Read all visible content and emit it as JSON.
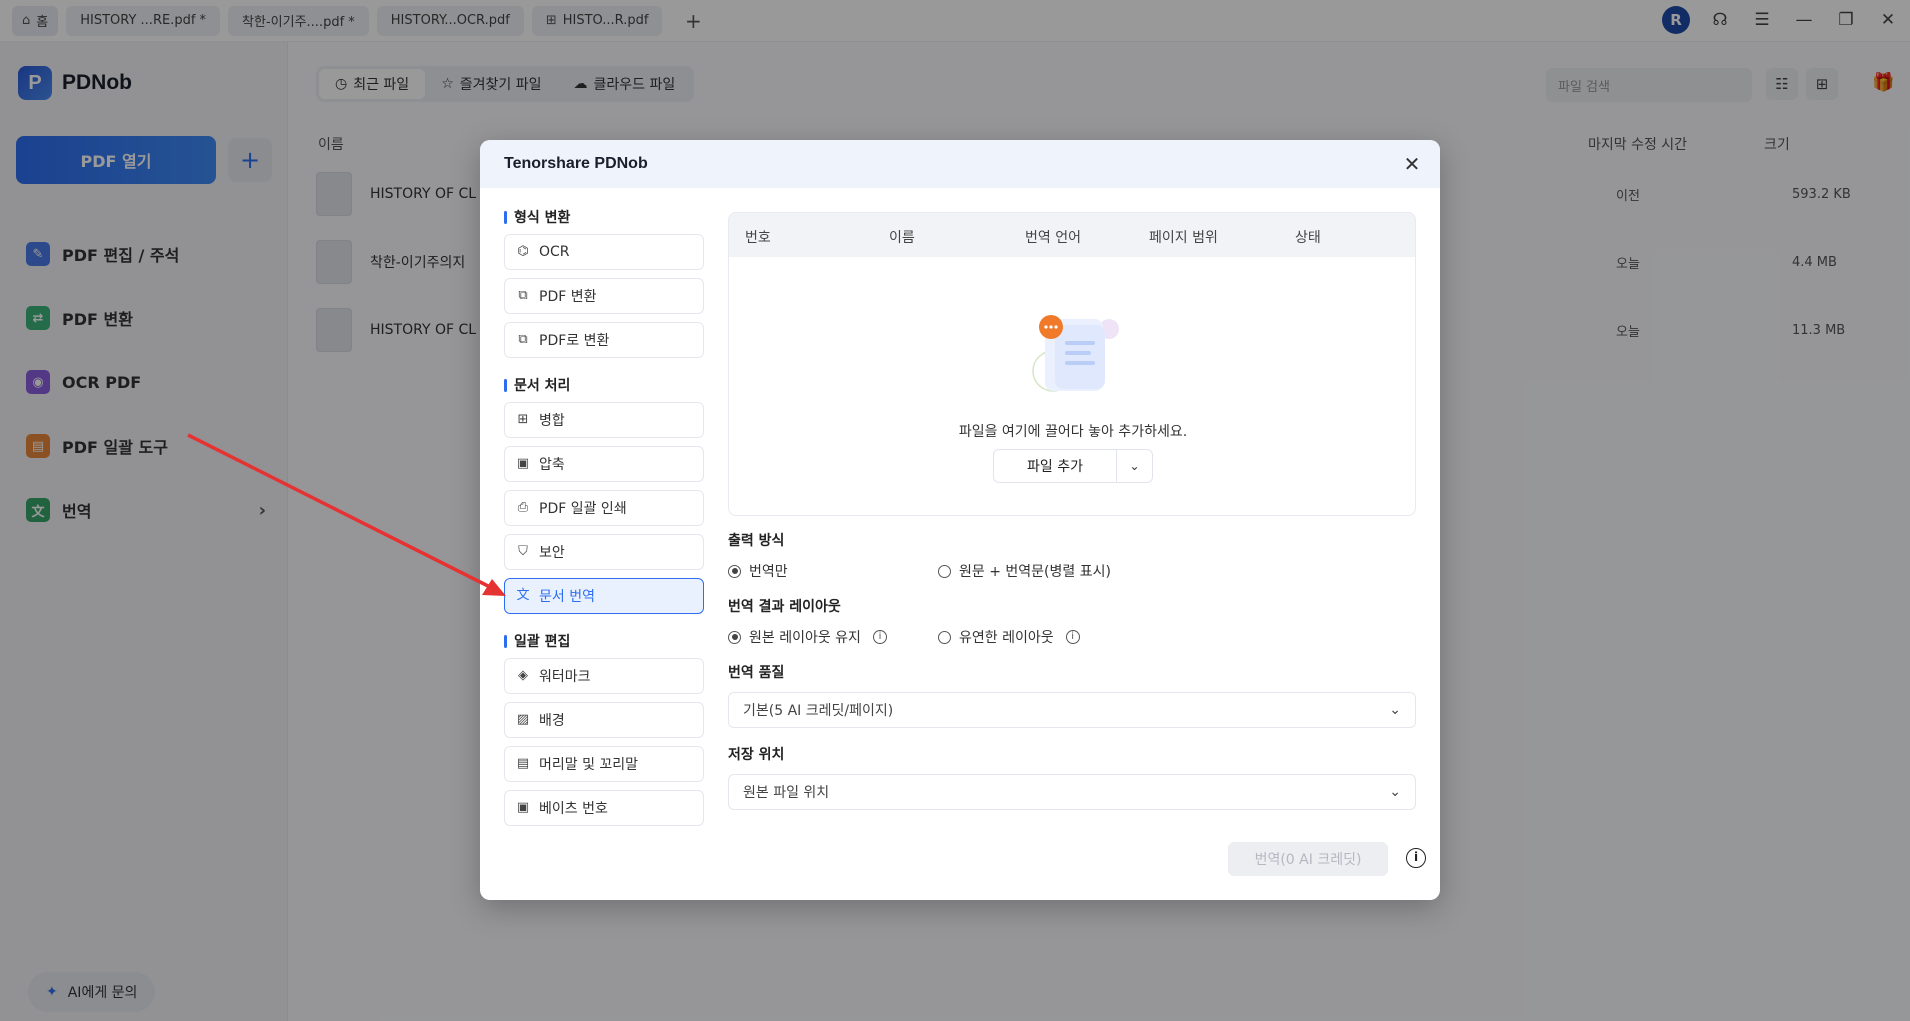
{
  "tabs": [
    {
      "label": "홈",
      "icon": "home-icon"
    },
    {
      "label": "HISTORY ...RE.pdf *"
    },
    {
      "label": "착한-이기주....pdf *"
    },
    {
      "label": "HISTORY...OCR.pdf"
    },
    {
      "label": "HISTO...R.pdf",
      "icon": "grid-icon"
    }
  ],
  "window": {
    "avatar": "R"
  },
  "brand": {
    "logo": "P",
    "name": "PDNob"
  },
  "sidebar": {
    "open_pdf": "PDF 열기",
    "add": "+",
    "items": [
      {
        "label": "PDF 편집 / 주석",
        "color": "#4a7be8"
      },
      {
        "label": "PDF 변환",
        "color": "#3bb37a"
      },
      {
        "label": "OCR PDF",
        "color": "#8a5ee0"
      },
      {
        "label": "PDF 일괄 도구",
        "color": "#e8873a"
      },
      {
        "label": "번역",
        "color": "#3aa56a"
      }
    ],
    "ask_ai": "AI에게 문의"
  },
  "main": {
    "tabs": [
      "최근 파일",
      "즐겨찾기 파일",
      "클라우드 파일"
    ],
    "search_placeholder": "파일 검색",
    "columns": {
      "name": "이름",
      "modified": "마지막 수정 시간",
      "size": "크기"
    },
    "files": [
      {
        "name": "HISTORY OF CL",
        "modified": "이전",
        "size": "593.2 KB"
      },
      {
        "name": "착한-이기주의지",
        "modified": "오늘",
        "size": "4.4 MB"
      },
      {
        "name": "HISTORY OF CL",
        "modified": "오늘",
        "size": "11.3 MB"
      }
    ]
  },
  "modal": {
    "title": "Tenorshare PDNob",
    "sections": [
      {
        "title": "형식 변환",
        "items": [
          {
            "label": "OCR",
            "icon": "ocr-icon"
          },
          {
            "label": "PDF 변환",
            "icon": "convert-icon"
          },
          {
            "label": "PDF로 변환",
            "icon": "to-pdf-icon"
          }
        ]
      },
      {
        "title": "문서 처리",
        "items": [
          {
            "label": "병합",
            "icon": "merge-icon"
          },
          {
            "label": "압축",
            "icon": "compress-icon"
          },
          {
            "label": "PDF 일괄 인쇄",
            "icon": "print-icon"
          },
          {
            "label": "보안",
            "icon": "shield-icon"
          },
          {
            "label": "문서 번역",
            "icon": "translate-icon",
            "active": true
          }
        ]
      },
      {
        "title": "일괄 편집",
        "items": [
          {
            "label": "워터마크",
            "icon": "watermark-icon"
          },
          {
            "label": "배경",
            "icon": "background-icon"
          },
          {
            "label": "머리말 및 꼬리말",
            "icon": "header-footer-icon"
          },
          {
            "label": "베이츠 번호",
            "icon": "bates-icon"
          }
        ]
      }
    ],
    "table_headers": [
      "번호",
      "이름",
      "번역 언어",
      "페이지 범위",
      "상태"
    ],
    "empty_text": "파일을 여기에 끌어다 놓아 추가하세요.",
    "add_file": "파일 추가",
    "output": {
      "title": "출력 방식",
      "options": [
        "번역만",
        "원문 + 번역문(병렬 표시)"
      ],
      "selected": 0
    },
    "layout": {
      "title": "번역 결과 레이아웃",
      "options": [
        "원본 레이아웃 유지",
        "유연한 레이아웃"
      ],
      "selected": 0
    },
    "quality": {
      "title": "번역 품질",
      "value": "기본(5 AI 크레딧/페이지)"
    },
    "save": {
      "title": "저장 위치",
      "value": "원본 파일 위치"
    },
    "translate_button": "번역(0 AI 크레딧)"
  },
  "annotation": {
    "arrow_color": "#e53232"
  }
}
